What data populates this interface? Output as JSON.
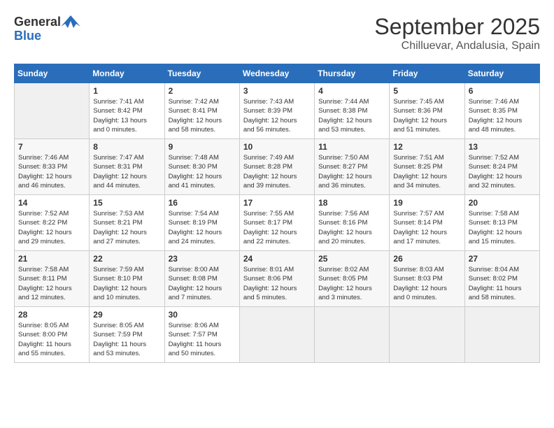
{
  "header": {
    "logo_general": "General",
    "logo_blue": "Blue",
    "month": "September 2025",
    "location": "Chilluevar, Andalusia, Spain"
  },
  "days_of_week": [
    "Sunday",
    "Monday",
    "Tuesday",
    "Wednesday",
    "Thursday",
    "Friday",
    "Saturday"
  ],
  "weeks": [
    [
      {
        "day": "",
        "info": ""
      },
      {
        "day": "1",
        "info": "Sunrise: 7:41 AM\nSunset: 8:42 PM\nDaylight: 13 hours\nand 0 minutes."
      },
      {
        "day": "2",
        "info": "Sunrise: 7:42 AM\nSunset: 8:41 PM\nDaylight: 12 hours\nand 58 minutes."
      },
      {
        "day": "3",
        "info": "Sunrise: 7:43 AM\nSunset: 8:39 PM\nDaylight: 12 hours\nand 56 minutes."
      },
      {
        "day": "4",
        "info": "Sunrise: 7:44 AM\nSunset: 8:38 PM\nDaylight: 12 hours\nand 53 minutes."
      },
      {
        "day": "5",
        "info": "Sunrise: 7:45 AM\nSunset: 8:36 PM\nDaylight: 12 hours\nand 51 minutes."
      },
      {
        "day": "6",
        "info": "Sunrise: 7:46 AM\nSunset: 8:35 PM\nDaylight: 12 hours\nand 48 minutes."
      }
    ],
    [
      {
        "day": "7",
        "info": "Sunrise: 7:46 AM\nSunset: 8:33 PM\nDaylight: 12 hours\nand 46 minutes."
      },
      {
        "day": "8",
        "info": "Sunrise: 7:47 AM\nSunset: 8:31 PM\nDaylight: 12 hours\nand 44 minutes."
      },
      {
        "day": "9",
        "info": "Sunrise: 7:48 AM\nSunset: 8:30 PM\nDaylight: 12 hours\nand 41 minutes."
      },
      {
        "day": "10",
        "info": "Sunrise: 7:49 AM\nSunset: 8:28 PM\nDaylight: 12 hours\nand 39 minutes."
      },
      {
        "day": "11",
        "info": "Sunrise: 7:50 AM\nSunset: 8:27 PM\nDaylight: 12 hours\nand 36 minutes."
      },
      {
        "day": "12",
        "info": "Sunrise: 7:51 AM\nSunset: 8:25 PM\nDaylight: 12 hours\nand 34 minutes."
      },
      {
        "day": "13",
        "info": "Sunrise: 7:52 AM\nSunset: 8:24 PM\nDaylight: 12 hours\nand 32 minutes."
      }
    ],
    [
      {
        "day": "14",
        "info": "Sunrise: 7:52 AM\nSunset: 8:22 PM\nDaylight: 12 hours\nand 29 minutes."
      },
      {
        "day": "15",
        "info": "Sunrise: 7:53 AM\nSunset: 8:21 PM\nDaylight: 12 hours\nand 27 minutes."
      },
      {
        "day": "16",
        "info": "Sunrise: 7:54 AM\nSunset: 8:19 PM\nDaylight: 12 hours\nand 24 minutes."
      },
      {
        "day": "17",
        "info": "Sunrise: 7:55 AM\nSunset: 8:17 PM\nDaylight: 12 hours\nand 22 minutes."
      },
      {
        "day": "18",
        "info": "Sunrise: 7:56 AM\nSunset: 8:16 PM\nDaylight: 12 hours\nand 20 minutes."
      },
      {
        "day": "19",
        "info": "Sunrise: 7:57 AM\nSunset: 8:14 PM\nDaylight: 12 hours\nand 17 minutes."
      },
      {
        "day": "20",
        "info": "Sunrise: 7:58 AM\nSunset: 8:13 PM\nDaylight: 12 hours\nand 15 minutes."
      }
    ],
    [
      {
        "day": "21",
        "info": "Sunrise: 7:58 AM\nSunset: 8:11 PM\nDaylight: 12 hours\nand 12 minutes."
      },
      {
        "day": "22",
        "info": "Sunrise: 7:59 AM\nSunset: 8:10 PM\nDaylight: 12 hours\nand 10 minutes."
      },
      {
        "day": "23",
        "info": "Sunrise: 8:00 AM\nSunset: 8:08 PM\nDaylight: 12 hours\nand 7 minutes."
      },
      {
        "day": "24",
        "info": "Sunrise: 8:01 AM\nSunset: 8:06 PM\nDaylight: 12 hours\nand 5 minutes."
      },
      {
        "day": "25",
        "info": "Sunrise: 8:02 AM\nSunset: 8:05 PM\nDaylight: 12 hours\nand 3 minutes."
      },
      {
        "day": "26",
        "info": "Sunrise: 8:03 AM\nSunset: 8:03 PM\nDaylight: 12 hours\nand 0 minutes."
      },
      {
        "day": "27",
        "info": "Sunrise: 8:04 AM\nSunset: 8:02 PM\nDaylight: 11 hours\nand 58 minutes."
      }
    ],
    [
      {
        "day": "28",
        "info": "Sunrise: 8:05 AM\nSunset: 8:00 PM\nDaylight: 11 hours\nand 55 minutes."
      },
      {
        "day": "29",
        "info": "Sunrise: 8:05 AM\nSunset: 7:59 PM\nDaylight: 11 hours\nand 53 minutes."
      },
      {
        "day": "30",
        "info": "Sunrise: 8:06 AM\nSunset: 7:57 PM\nDaylight: 11 hours\nand 50 minutes."
      },
      {
        "day": "",
        "info": ""
      },
      {
        "day": "",
        "info": ""
      },
      {
        "day": "",
        "info": ""
      },
      {
        "day": "",
        "info": ""
      }
    ]
  ]
}
